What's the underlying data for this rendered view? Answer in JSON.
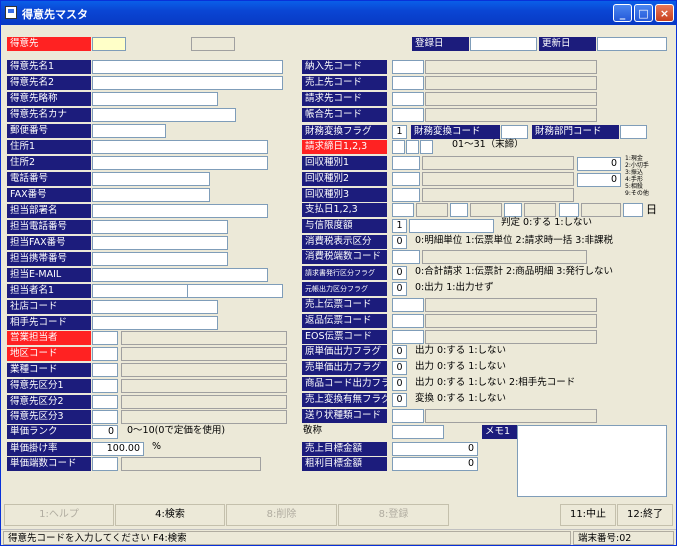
{
  "window": {
    "title": "得意先マスタ",
    "min": "_",
    "max": "□",
    "close": "×"
  },
  "header": {
    "code_label": "得意先",
    "reg_label": "登録日",
    "upd_label": "更新日"
  },
  "left_labels": [
    "得意先名1",
    "得意先名2",
    "得意先略称",
    "得意先名カナ",
    "郵便番号",
    "住所1",
    "住所2",
    "電話番号",
    "FAX番号",
    "担当部署名",
    "担当電話番号",
    "担当FAX番号",
    "担当携帯番号",
    "担当E-MAIL",
    "担当者名1",
    "社店コード",
    "相手先コード",
    "営業担当者",
    "地区コード",
    "業種コード",
    "得意先区分1",
    "得意先区分2",
    "得意先区分3",
    "単価ランク",
    "単価掛け率",
    "単価端数コード"
  ],
  "left_values": {
    "price_rank": "0",
    "price_rate": "100.00"
  },
  "left_notes": {
    "rank_note": "0～10(0で定価を使用)",
    "rate_unit": "%"
  },
  "right_labels": [
    "納入先コード",
    "売上先コード",
    "請求先コード",
    "帳合先コード",
    "財務変換フラグ",
    "請求締日1,2,3",
    "回収種別1",
    "回収種別2",
    "回収種別3",
    "支払日1,2,3",
    "与信限度額",
    "消費税表示区分",
    "消費税端数コード",
    "請求書発行区分フラグ",
    "元帳出力区分フラグ",
    "売上伝票コード",
    "返品伝票コード",
    "EOS伝票コード",
    "原単価出力フラグ",
    "売単価出力フラグ",
    "商品コード出力フラグ",
    "売上変換有無フラグ",
    "送り状種類コード",
    "敬称",
    "売上目標金額",
    "粗利目標金額"
  ],
  "right_values": {
    "zaimu_flag": "1",
    "kaishu1_amt": "0",
    "kaishu2_amt": "0",
    "credit": "1",
    "tax_disp": "0",
    "invoice": "0",
    "ledger": "0",
    "genka": "0",
    "baika": "0",
    "shohin": "0",
    "henkan": "0",
    "sales_target": "0",
    "gross_target": "0"
  },
  "right_notes": {
    "zaimu_code": "財務変換コード",
    "zaimu_dept": "財務部門コード",
    "shime_range": "01～31（末締）",
    "kaishu_legend": [
      "1:現金",
      "2:小切手",
      "3:振込",
      "4:手形",
      "5:相殺",
      "9:その他"
    ],
    "pay_day_unit": "日",
    "credit_note": "判定 0:する 1:しない",
    "tax_disp_note": "0:明細単位 1:伝票単位 2:請求時一括 3:非課税",
    "invoice_note": "0:合計請求 1:伝票計 2:商品明細 3:発行しない",
    "ledger_note": "0:出力 1:出力せず",
    "genka_note": "出力 0:する 1:しない",
    "baika_note": "出力 0:する 1:しない",
    "shohin_note": "出力 0:する 1:しない 2:相手先コード",
    "henkan_note": "変換 0:する 1:しない",
    "memo_label": "メモ1"
  },
  "buttons": [
    "1:ヘルプ",
    "4:検索",
    "8:削除",
    "8:登録",
    "11:中止",
    "12:終了"
  ],
  "status": {
    "message": "得意先コードを入力してください F4:検索",
    "terminal": "端末番号:02"
  }
}
